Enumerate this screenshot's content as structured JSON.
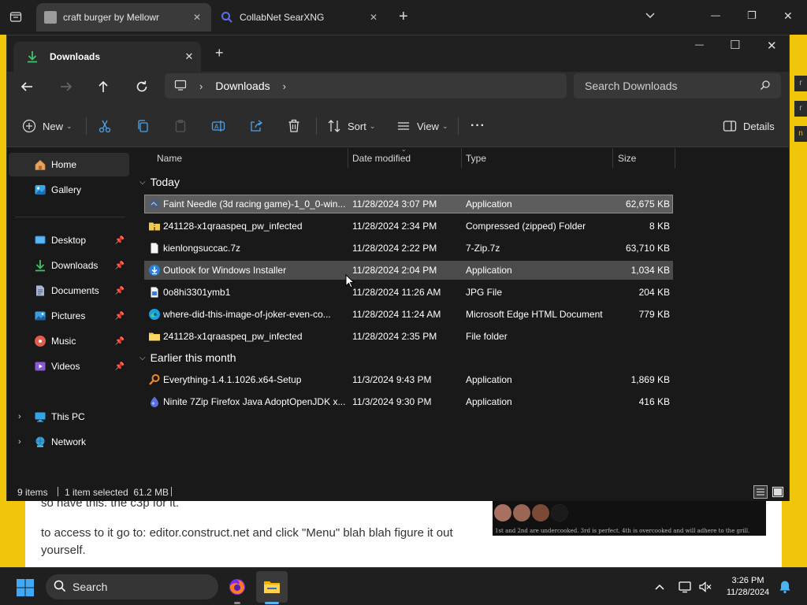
{
  "browser": {
    "tabs": [
      {
        "label": "craft burger by Mellowr",
        "active": true
      },
      {
        "label": "CollabNet SearXNG",
        "active": false
      }
    ],
    "new_tab_symbol": "+",
    "dropdown_symbol": "⌄",
    "window_controls": {
      "minimize": "—",
      "maximize": "❐",
      "close": "✕"
    }
  },
  "webpage": {
    "text_partial": "so have this. the c3p for it.",
    "text": "to access to it go to: editor.construct.net and click \"Menu\" blah blah figure it out yourself.",
    "image_caption": "1st and 2nd are undercooked. 3rd is perfect. 4th is overcooked and will adhere to the grill.",
    "side_tags": [
      "r",
      "r",
      "n"
    ],
    "colors": {
      "page_bg": "#f1c60a",
      "content_bg": "#ffffff"
    }
  },
  "explorer": {
    "tab_label": "Downloads",
    "tab_close": "✕",
    "new_tab": "+",
    "window_controls": {
      "minimize": "—",
      "maximize": "☐",
      "close": "✕"
    },
    "address": {
      "location": "Downloads"
    },
    "search_placeholder": "Search Downloads",
    "toolbar": {
      "new_label": "New",
      "sort_label": "Sort",
      "view_label": "View",
      "more_label": "···",
      "details_label": "Details"
    },
    "sidebar": {
      "items": [
        {
          "label": "Home",
          "icon": "home-icon",
          "selected": true
        },
        {
          "label": "Gallery",
          "icon": "gallery-icon"
        },
        {
          "label": "Desktop",
          "icon": "desktop-icon",
          "pinned": true
        },
        {
          "label": "Downloads",
          "icon": "downloads-icon",
          "pinned": true
        },
        {
          "label": "Documents",
          "icon": "documents-icon",
          "pinned": true
        },
        {
          "label": "Pictures",
          "icon": "pictures-icon",
          "pinned": true
        },
        {
          "label": "Music",
          "icon": "music-icon",
          "pinned": true
        },
        {
          "label": "Videos",
          "icon": "videos-icon",
          "pinned": true
        },
        {
          "label": "This PC",
          "icon": "this-pc-icon",
          "expandable": true
        },
        {
          "label": "Network",
          "icon": "network-icon",
          "expandable": true
        }
      ]
    },
    "columns": [
      "Name",
      "Date modified",
      "Type",
      "Size"
    ],
    "groups": [
      {
        "label": "Today",
        "files": [
          {
            "name": "Faint Needle (3d racing game)-1_0_0-win...",
            "date": "11/28/2024 3:07 PM",
            "type": "Application",
            "size": "62,675 KB",
            "icon": "app-icon",
            "state": "selected"
          },
          {
            "name": "241128-x1qraaspeq_pw_infected",
            "date": "11/28/2024 2:34 PM",
            "type": "Compressed (zipped) Folder",
            "size": "8 KB",
            "icon": "zip-folder-icon"
          },
          {
            "name": "kienlongsuccac.7z",
            "date": "11/28/2024 2:22 PM",
            "type": "7-Zip.7z",
            "size": "63,710 KB",
            "icon": "file-icon"
          },
          {
            "name": "Outlook for Windows Installer",
            "date": "11/28/2024 2:04 PM",
            "type": "Application",
            "size": "1,034 KB",
            "icon": "installer-icon",
            "state": "hover"
          },
          {
            "name": "0o8hi3301ymb1",
            "date": "11/28/2024 11:26 AM",
            "type": "JPG File",
            "size": "204 KB",
            "icon": "jpg-file-icon"
          },
          {
            "name": "where-did-this-image-of-joker-even-co...",
            "date": "11/28/2024 11:24 AM",
            "type": "Microsoft Edge HTML Document",
            "size": "779 KB",
            "icon": "edge-icon"
          },
          {
            "name": "241128-x1qraaspeq_pw_infected",
            "date": "11/28/2024 2:35 PM",
            "type": "File folder",
            "size": "",
            "icon": "folder-icon"
          }
        ]
      },
      {
        "label": "Earlier this month",
        "files": [
          {
            "name": "Everything-1.4.1.1026.x64-Setup",
            "date": "11/3/2024 9:43 PM",
            "type": "Application",
            "size": "1,869 KB",
            "icon": "everything-icon"
          },
          {
            "name": "Ninite 7Zip Firefox Java AdoptOpenJDK x...",
            "date": "11/3/2024 9:30 PM",
            "type": "Application",
            "size": "416 KB",
            "icon": "ninite-icon"
          }
        ]
      }
    ],
    "status": {
      "items_count": "9 items",
      "selection": "1 item selected  61.2 MB"
    }
  },
  "taskbar": {
    "search_placeholder": "Search",
    "time": "3:26 PM",
    "date": "11/28/2024"
  }
}
